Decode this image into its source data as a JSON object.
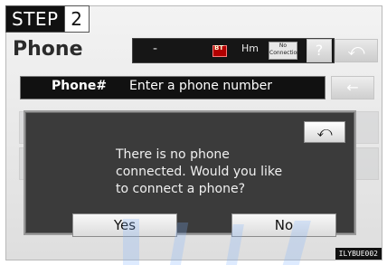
{
  "step": {
    "label": "STEP",
    "number": "2"
  },
  "header": {
    "title": "Phone",
    "dash": "-",
    "bt_icon": "bluetooth-icon",
    "hm": "Hm",
    "no_connection_line1": "No",
    "no_connection_line2": "Connection",
    "help": "?",
    "back_icon": "back-arrow-icon"
  },
  "phone_row": {
    "label": "Phone#",
    "placeholder": "Enter a phone number",
    "delete_icon": "backspace-icon"
  },
  "dialog": {
    "message_lines": [
      "There is no phone",
      "connected. Would you like",
      "to connect a phone?"
    ],
    "back_icon": "back-arrow-icon",
    "yes_label": "Yes",
    "no_label": "No"
  },
  "code": "ILYBUE002"
}
